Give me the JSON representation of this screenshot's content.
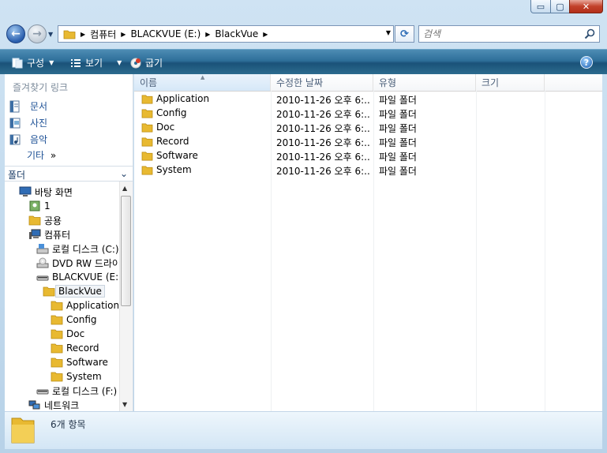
{
  "window": {
    "minimize_glyph": "▭",
    "maximize_glyph": "▢",
    "close_glyph": "✕"
  },
  "address_bar": {
    "breadcrumbs": [
      "컴퓨터",
      "BLACKVUE (E:)",
      "BlackVue"
    ]
  },
  "search": {
    "placeholder": "검색"
  },
  "toolbar": {
    "organize_label": "구성",
    "views_label": "보기",
    "burn_label": "굽기"
  },
  "nav_pane": {
    "favorites_title": "즐겨찾기 링크",
    "favorites": [
      {
        "label": "문서",
        "icon": "documents-icon"
      },
      {
        "label": "사진",
        "icon": "pictures-icon"
      },
      {
        "label": "음악",
        "icon": "music-icon"
      }
    ],
    "more_label": "기타",
    "more_chevron": "»",
    "folders_label": "폴더",
    "tree": [
      {
        "label": "바탕 화면",
        "icon": "desktop-icon"
      },
      {
        "label": "1",
        "icon": "user-folder-icon"
      },
      {
        "label": "공용",
        "icon": "folder-icon"
      },
      {
        "label": "컴퓨터",
        "icon": "computer-icon"
      },
      {
        "label": "로컬 디스크 (C:)",
        "icon": "hard-drive-icon"
      },
      {
        "label": "DVD RW 드라이",
        "icon": "dvd-drive-icon"
      },
      {
        "label": "BLACKVUE (E:)",
        "icon": "removable-drive-icon"
      },
      {
        "label": "BlackVue",
        "icon": "folder-icon"
      },
      {
        "label": "Application",
        "icon": "folder-icon"
      },
      {
        "label": "Config",
        "icon": "folder-icon"
      },
      {
        "label": "Doc",
        "icon": "folder-icon"
      },
      {
        "label": "Record",
        "icon": "folder-icon"
      },
      {
        "label": "Software",
        "icon": "folder-icon"
      },
      {
        "label": "System",
        "icon": "folder-icon"
      },
      {
        "label": "로컬 디스크 (F:)",
        "icon": "removable-drive-icon"
      },
      {
        "label": "네트워크",
        "icon": "network-icon"
      }
    ]
  },
  "columns": [
    "이름",
    "수정한 날짜",
    "유형",
    "크기"
  ],
  "files": [
    {
      "name": "Application",
      "modified": "2010-11-26 오후 6:...",
      "type": "파일 폴더",
      "size": ""
    },
    {
      "name": "Config",
      "modified": "2010-11-26 오후 6:...",
      "type": "파일 폴더",
      "size": ""
    },
    {
      "name": "Doc",
      "modified": "2010-11-26 오후 6:...",
      "type": "파일 폴더",
      "size": ""
    },
    {
      "name": "Record",
      "modified": "2010-11-26 오후 6:...",
      "type": "파일 폴더",
      "size": ""
    },
    {
      "name": "Software",
      "modified": "2010-11-26 오후 6:...",
      "type": "파일 폴더",
      "size": ""
    },
    {
      "name": "System",
      "modified": "2010-11-26 오후 6:...",
      "type": "파일 폴더",
      "size": ""
    }
  ],
  "details": {
    "item_count": "6개 항목"
  },
  "colors": {
    "toolbar": "#2e6f99",
    "link": "#1e5196",
    "folder": "#e8b931"
  }
}
